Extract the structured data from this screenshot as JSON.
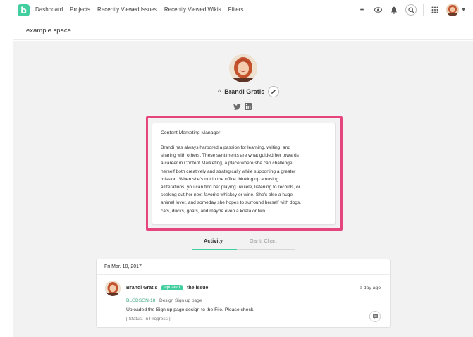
{
  "nav": {
    "logo_letter": "b",
    "items": [
      "Dashboard",
      "Projects",
      "Recently Viewed Issues",
      "Recently Viewed Wikis",
      "Filters"
    ],
    "more_label": "•••",
    "icons": [
      "more-icon",
      "eye-icon",
      "bell-icon",
      "search-icon",
      "apps-grid-icon",
      "user-avatar-icon",
      "chevron-down-icon"
    ]
  },
  "space": {
    "name": "example space"
  },
  "profile": {
    "name": "Brandi Gratis",
    "social": [
      "twitter-icon",
      "linkedin-icon"
    ],
    "bio_title": "Content Marketing Manager",
    "bio_lines": [
      "Brandi has always harbored a passion for learning, writing, and",
      "sharing with others. These sentiments are what guided her towards",
      "a career in Content Marketing, a place where she can challenge",
      "herself both creatively and strategically while supporting a greater",
      "mission. When she's not in the office thinking up amusing",
      "alliterations, you can find her playing ukulele, listening to records, or",
      "seeking out her next favorite whiskey or wine. She's also a huge",
      "animal lover, and someday she hopes to surround herself with dogs,",
      "cats, ducks, goats, and maybe even a koala or two."
    ]
  },
  "tabs": {
    "activity": "Activity",
    "gantt": "Gantt Chart"
  },
  "activity": {
    "date": "Fri Mar. 10, 2017",
    "user": "Brandi Gratis",
    "badge": "updated",
    "verb": "the issue",
    "time": "a day ago",
    "issue_key": "BLGDSGN-18",
    "issue_summary": "Design Sign up page",
    "comment": "Uploaded the Sign up page design to the File. Please check.",
    "status": "[ Status: In Progress ]"
  },
  "colors": {
    "accent": "#42ce9f",
    "highlight": "#e6447d",
    "background": "#f2f2f2"
  }
}
